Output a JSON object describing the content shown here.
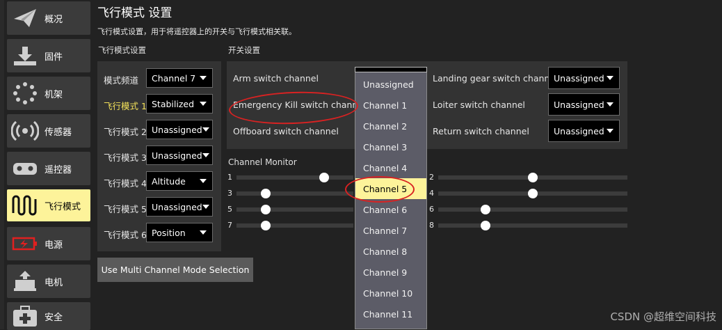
{
  "sidebar": {
    "items": [
      {
        "label": "概况",
        "icon": "paper-plane-icon"
      },
      {
        "label": "固件",
        "icon": "download-icon"
      },
      {
        "label": "机架",
        "icon": "frame-icon"
      },
      {
        "label": "传感器",
        "icon": "radio-waves-icon"
      },
      {
        "label": "遥控器",
        "icon": "gamepad-icon"
      },
      {
        "label": "飞行模式",
        "icon": "wave-icon"
      },
      {
        "label": "电源",
        "icon": "battery-icon"
      },
      {
        "label": "电机",
        "icon": "motor-icon"
      },
      {
        "label": "安全",
        "icon": "medkit-icon"
      }
    ],
    "active_index": 5
  },
  "header": {
    "title": "飞行模式 设置",
    "subtitle": "飞行模式设置，用于将遥控器上的开关与飞行模式相关联。"
  },
  "mode_settings": {
    "section_label": "飞行模式设置",
    "channel_label": "模式频道",
    "channel_value": "Channel 7",
    "rows": [
      {
        "label": "飞行模式 1",
        "value": "Stabilized",
        "highlight": true
      },
      {
        "label": "飞行模式 2",
        "value": "Unassigned",
        "highlight": false
      },
      {
        "label": "飞行模式 3",
        "value": "Unassigned",
        "highlight": false
      },
      {
        "label": "飞行模式 4",
        "value": "Altitude",
        "highlight": false
      },
      {
        "label": "飞行模式 5",
        "value": "Unassigned",
        "highlight": false
      },
      {
        "label": "飞行模式 6",
        "value": "Position",
        "highlight": false
      }
    ]
  },
  "switch_settings": {
    "section_label": "开关设置",
    "left": [
      {
        "label": "Arm switch channel"
      },
      {
        "label": "Emergency Kill switch channel"
      },
      {
        "label": "Offboard switch channel"
      }
    ],
    "right": [
      {
        "label": "Landing gear switch channel",
        "value": "Unassigned"
      },
      {
        "label": "Loiter switch channel",
        "value": "Unassigned"
      },
      {
        "label": "Return switch channel",
        "value": "Unassigned"
      }
    ]
  },
  "channel_monitor": {
    "label": "Channel Monitor",
    "channels": [
      {
        "num": "1",
        "level": 0.75
      },
      {
        "num": "2",
        "level": 0.5
      },
      {
        "num": "3",
        "level": 0.25
      },
      {
        "num": "4",
        "level": 0.5
      },
      {
        "num": "5",
        "level": 0.25
      },
      {
        "num": "6",
        "level": 0.25
      },
      {
        "num": "7",
        "level": 0.25
      },
      {
        "num": "8",
        "level": 0.25
      }
    ]
  },
  "multi_channel_button": "Use Multi Channel Mode Selection",
  "dropdown": {
    "options": [
      "Unassigned",
      "Channel 1",
      "Channel 2",
      "Channel 3",
      "Channel 4",
      "Channel 5",
      "Channel 6",
      "Channel 7",
      "Channel 8",
      "Channel 9",
      "Channel 10",
      "Channel 11"
    ],
    "selected_index": 5
  },
  "watermark": "CSDN @超维空间科技",
  "colors": {
    "background": "#222222",
    "panel": "#333333",
    "active": "#fdf39a",
    "highlight_text": "#f4e25a",
    "annotation": "#d92222"
  }
}
